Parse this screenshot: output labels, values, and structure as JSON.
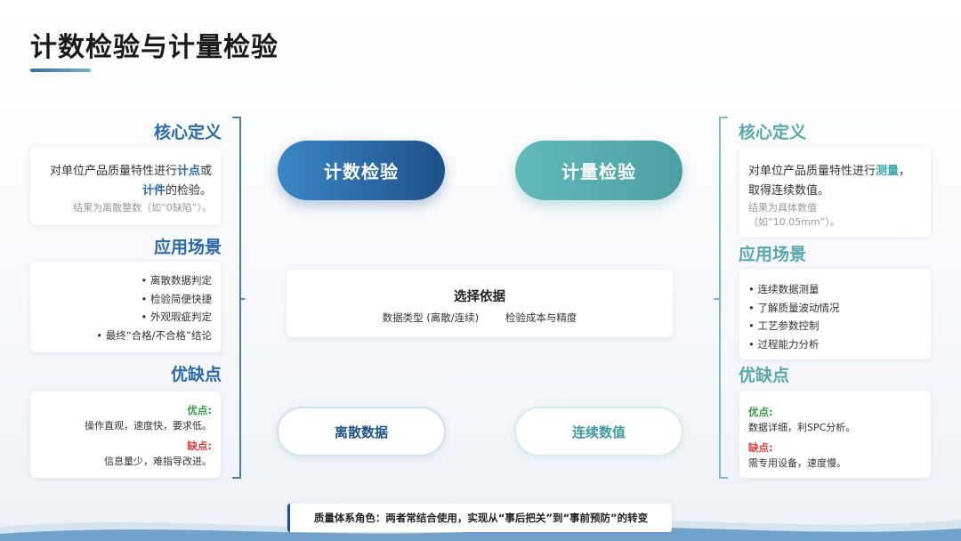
{
  "title": "计数检验与计量检验",
  "left": {
    "definition_title": "核心定义",
    "definition": {
      "part1": "对单位产品质量特性进行",
      "hl1": "计点",
      "part2": "或",
      "hl2": "计件",
      "part3": "的检验。",
      "note": "结果为离散整数（如“0缺陷”）。"
    },
    "scenario_title": "应用场景",
    "scenarios": [
      "• 离散数据判定",
      "• 检验简便快捷",
      "• 外观瑕疵判定",
      "• 最终“合格/不合格”结论"
    ],
    "proscons_title": "优缺点",
    "pros_label": "优点:",
    "pros_text": "操作直观，速度快，要求低。",
    "cons_label": "缺点:",
    "cons_text": "信息量少，难指导改进。"
  },
  "right": {
    "definition_title": "核心定义",
    "definition": {
      "part1": "对单位产品质量特性进行",
      "hl1": "测量",
      "part2": "，",
      "part3": "取得连续数值。",
      "note": "结果为具体数值（如“10.05mm”）。"
    },
    "scenario_title": "应用场景",
    "scenarios": [
      "• 连续数据测量",
      "• 了解质量波动情况",
      "• 工艺参数控制",
      "• 过程能力分析"
    ],
    "proscons_title": "优缺点",
    "pros_label": "优点:",
    "pros_text": "数据详细，利SPC分析。",
    "cons_label": "缺点:",
    "cons_text": "需专用设备，速度慢。"
  },
  "center": {
    "count_label": "计数检验",
    "measure_label": "计量检验",
    "basis_title": "选择依据",
    "basis_item1": "数据类型 (离散/连续)",
    "basis_item2": "检验成本与精度",
    "discrete_label": "离散数据",
    "continuous_label": "连续数值"
  },
  "footer_note": "质量体系角色：两者常结合使用，实现从“事后把关”到“事前预防”的转变",
  "colors": {
    "blue": "#1f5189",
    "teal": "#4a9fa3",
    "pro_green": "#2e9b3e",
    "con_red": "#e23c3c"
  }
}
